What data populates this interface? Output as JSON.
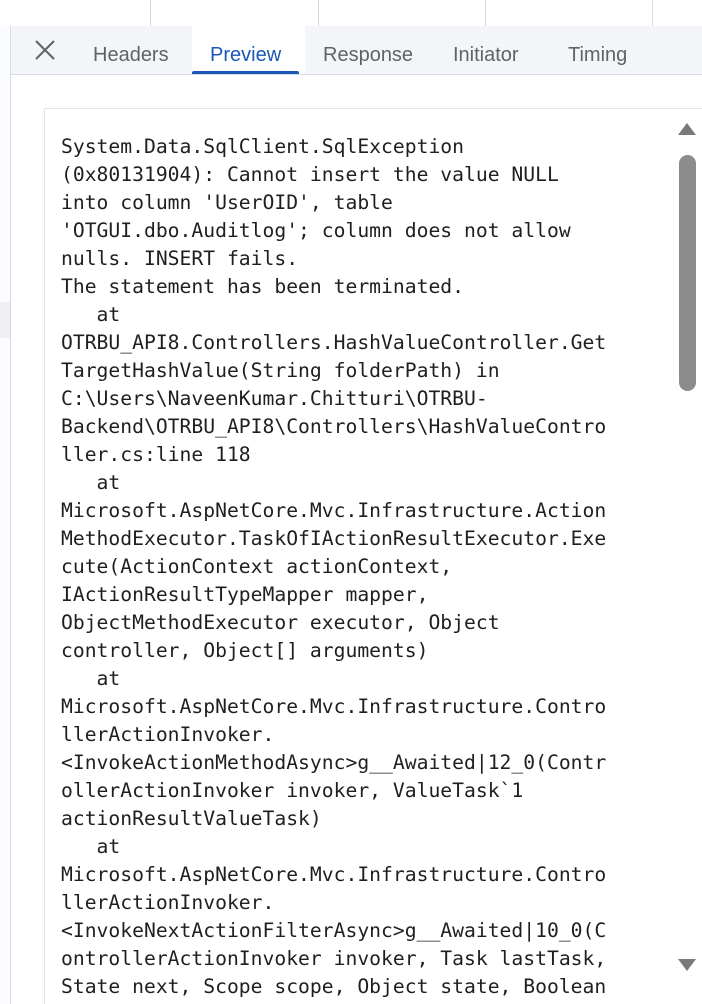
{
  "tabs": [
    {
      "label": "Headers",
      "active": false
    },
    {
      "label": "Preview",
      "active": true
    },
    {
      "label": "Response",
      "active": false
    },
    {
      "label": "Initiator",
      "active": false
    },
    {
      "label": "Timing",
      "active": false
    }
  ],
  "preview": {
    "error_lines": [
      "System.Data.SqlClient.SqlException",
      "(0x80131904): Cannot insert the value NULL",
      "into column 'UserOID', table",
      "'OTGUI.dbo.Auditlog'; column does not allow",
      "nulls. INSERT fails.",
      "The statement has been terminated.",
      "   at",
      "OTRBU_API8.Controllers.HashValueController.Get",
      "TargetHashValue(String folderPath) in",
      "C:\\Users\\NaveenKumar.Chitturi\\OTRBU-",
      "Backend\\OTRBU_API8\\Controllers\\HashValueContro",
      "ller.cs:line 118",
      "   at",
      "Microsoft.AspNetCore.Mvc.Infrastructure.Action",
      "MethodExecutor.TaskOfIActionResultExecutor.Exe",
      "cute(ActionContext actionContext,",
      "IActionResultTypeMapper mapper,",
      "ObjectMethodExecutor executor, Object",
      "controller, Object[] arguments)",
      "   at",
      "Microsoft.AspNetCore.Mvc.Infrastructure.Contro",
      "llerActionInvoker.",
      "<InvokeActionMethodAsync>g__Awaited|12_0(Contr",
      "ollerActionInvoker invoker, ValueTask`1",
      "actionResultValueTask)",
      "   at",
      "Microsoft.AspNetCore.Mvc.Infrastructure.Contro",
      "llerActionInvoker.",
      "<InvokeNextActionFilterAsync>g__Awaited|10_0(C",
      "ontrollerActionInvoker invoker, Task lastTask,",
      "State next, Scope scope, Object state, Boolean"
    ]
  },
  "icons": {
    "close": "close-icon",
    "scroll_up": "scroll-up-arrow-icon",
    "scroll_down": "scroll-down-arrow-icon"
  },
  "colors": {
    "accent": "#1a57b8",
    "tab_text": "#5f6368",
    "tab_bar_bg": "#f3f5f8",
    "code_text": "#1f1f1f"
  }
}
